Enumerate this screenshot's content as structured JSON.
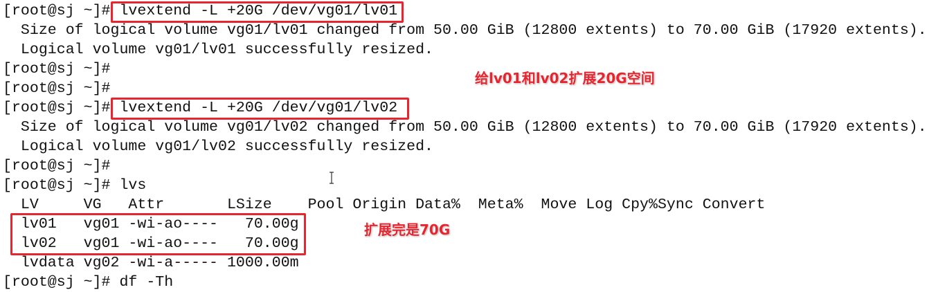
{
  "terminal": {
    "lines": [
      "[root@sj ~]# lvextend -L +20G /dev/vg01/lv01",
      "  Size of logical volume vg01/lv01 changed from 50.00 GiB (12800 extents) to 70.00 GiB (17920 extents).",
      "  Logical volume vg01/lv01 successfully resized.",
      "[root@sj ~]#",
      "[root@sj ~]#",
      "[root@sj ~]# lvextend -L +20G /dev/vg01/lv02",
      "  Size of logical volume vg01/lv02 changed from 50.00 GiB (12800 extents) to 70.00 GiB (17920 extents).",
      "  Logical volume vg01/lv02 successfully resized.",
      "[root@sj ~]#",
      "[root@sj ~]# lvs",
      "  LV     VG   Attr       LSize    Pool Origin Data%  Meta%  Move Log Cpy%Sync Convert",
      "  lv01   vg01 -wi-ao----   70.00g",
      "  lv02   vg01 -wi-ao----   70.00g",
      "  lvdata vg02 -wi-a----- 1000.00m",
      "[root@sj ~]# df -Th"
    ]
  },
  "annotations": {
    "extend_note": "给lv01和lv02扩展20G空间",
    "result_note": "扩展完是70G"
  },
  "colors": {
    "highlight": "#e8252e",
    "text": "#111111",
    "background": "#ffffff"
  }
}
